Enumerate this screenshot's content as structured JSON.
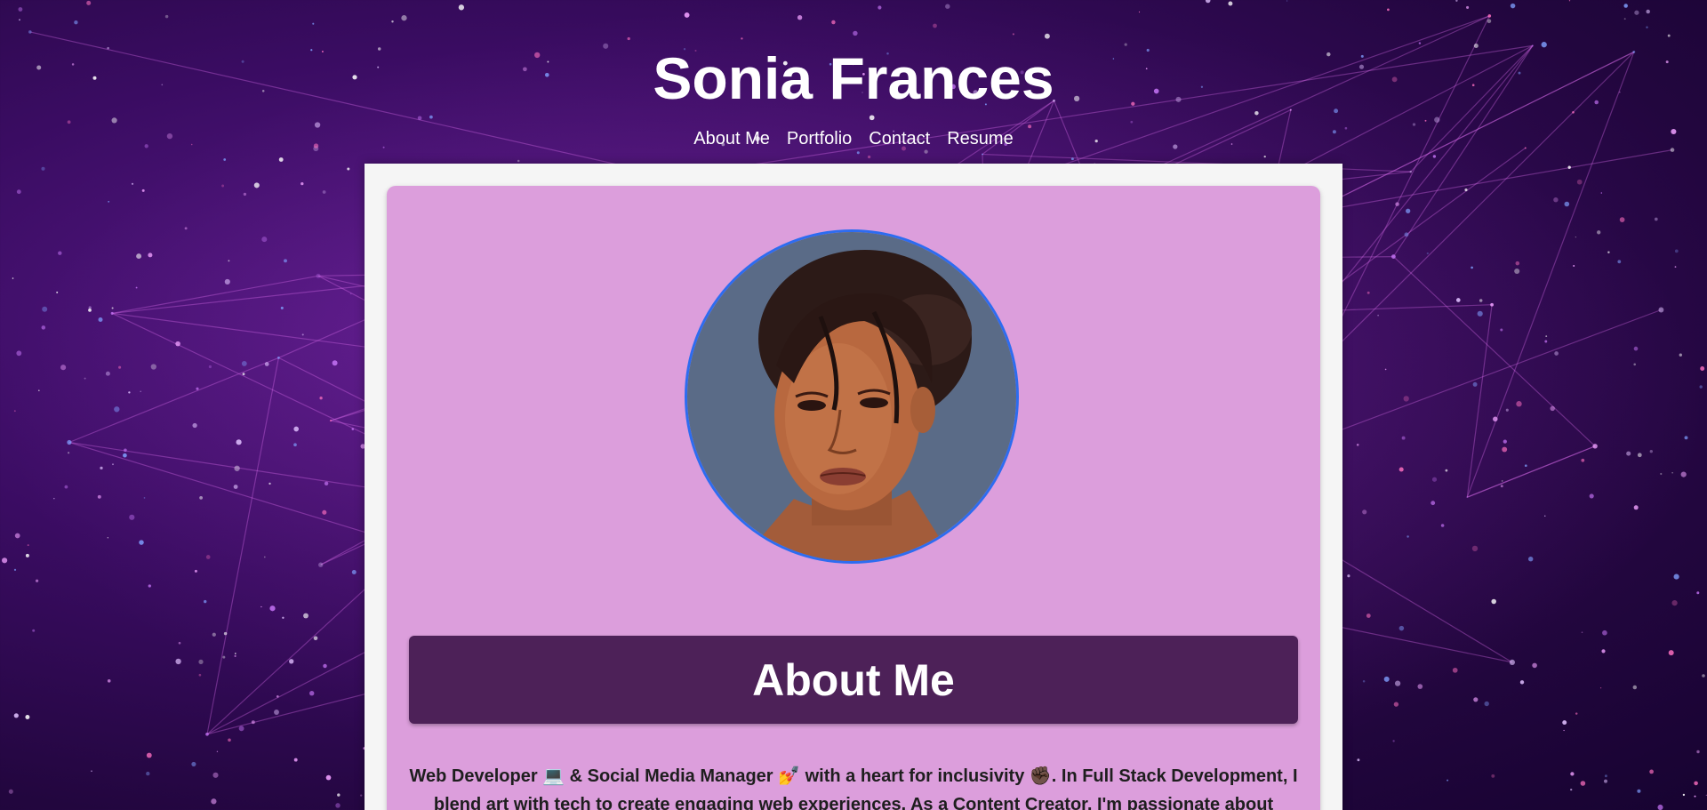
{
  "site": {
    "title": "Sonia Frances"
  },
  "nav": [
    {
      "label": "About Me"
    },
    {
      "label": "Portfolio"
    },
    {
      "label": "Contact"
    },
    {
      "label": "Resume"
    }
  ],
  "about": {
    "heading": "About Me",
    "bio": "Web Developer 💻 & Social Media Manager 💅 with a heart for inclusivity ✊🏿. In Full Stack Development, I blend art with tech to create engaging web experiences. As a Content Creator, I'm passionate about"
  },
  "colors": {
    "card_bg": "#dc9edc",
    "heading_bg": "#4d2158",
    "avatar_border": "#2d6cf0",
    "panel_bg": "#f5f5f5"
  }
}
